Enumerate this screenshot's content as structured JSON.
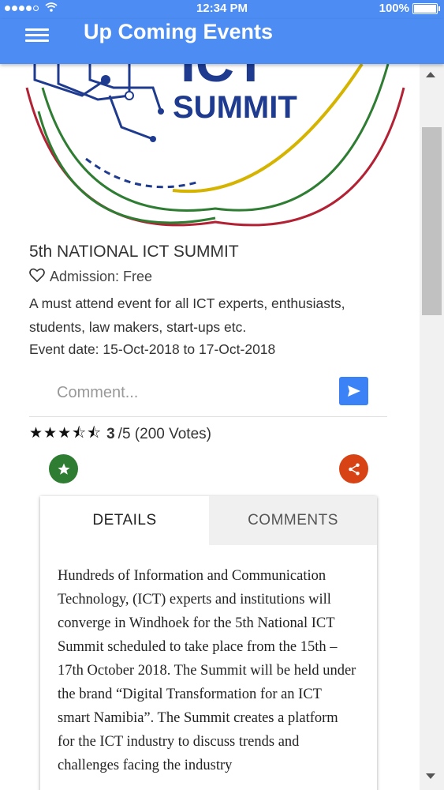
{
  "status_bar": {
    "time": "12:34 PM",
    "battery": "100%"
  },
  "app_bar": {
    "title": "Up Coming Events"
  },
  "event": {
    "logo_text": "ICT",
    "logo_subtext": "SUMMIT",
    "title": "5th NATIONAL ICT SUMMIT",
    "admission": "Admission: Free",
    "description": "A must attend event for all ICT experts, enthusiasts, students, law makers, start-ups etc.",
    "date": "Event date: 15-Oct-2018 to 17-Oct-2018"
  },
  "comment": {
    "placeholder": "Comment..."
  },
  "rating": {
    "stars": "★★★⯪⯪",
    "score": "3",
    "out_of": "/5 (200 Votes)",
    "value": 3
  },
  "tabs": [
    {
      "label": "DETAILS",
      "active": true
    },
    {
      "label": "COMMENTS",
      "active": false
    }
  ],
  "details_text": "Hundreds of Information and Communication Technology, (ICT) experts and institutions will converge in Windhoek for the 5th National ICT Summit scheduled to take place from the 15th – 17th October 2018. The Summit will be held under the brand “Digital Transformation for an ICT smart Namibia”. The Summit creates a platform for the ICT industry to discuss trends and challenges facing the industry",
  "colors": {
    "primary": "#4d8df3",
    "send": "#3b82f6",
    "favorite": "#2e7d32",
    "share": "#d84315",
    "logo_navy": "#1f3b8f"
  },
  "icons": [
    "menu-icon",
    "heart-outline-icon",
    "send-icon",
    "star-icon",
    "share-icon"
  ]
}
